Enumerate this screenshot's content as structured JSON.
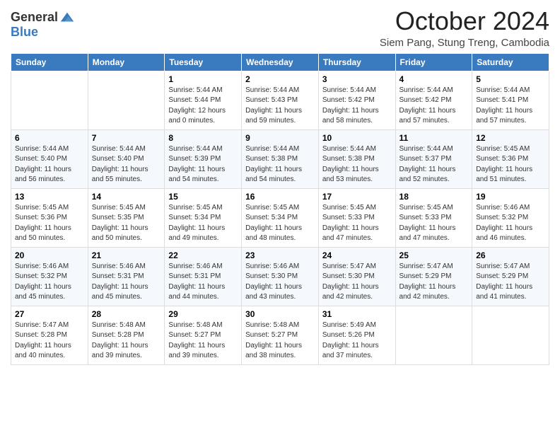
{
  "header": {
    "logo_general": "General",
    "logo_blue": "Blue",
    "title": "October 2024",
    "subtitle": "Siem Pang, Stung Treng, Cambodia"
  },
  "columns": [
    "Sunday",
    "Monday",
    "Tuesday",
    "Wednesday",
    "Thursday",
    "Friday",
    "Saturday"
  ],
  "weeks": [
    [
      {
        "day": null,
        "sunrise": null,
        "sunset": null,
        "daylight": null
      },
      {
        "day": null,
        "sunrise": null,
        "sunset": null,
        "daylight": null
      },
      {
        "day": "1",
        "sunrise": "Sunrise: 5:44 AM",
        "sunset": "Sunset: 5:44 PM",
        "daylight": "Daylight: 12 hours and 0 minutes."
      },
      {
        "day": "2",
        "sunrise": "Sunrise: 5:44 AM",
        "sunset": "Sunset: 5:43 PM",
        "daylight": "Daylight: 11 hours and 59 minutes."
      },
      {
        "day": "3",
        "sunrise": "Sunrise: 5:44 AM",
        "sunset": "Sunset: 5:42 PM",
        "daylight": "Daylight: 11 hours and 58 minutes."
      },
      {
        "day": "4",
        "sunrise": "Sunrise: 5:44 AM",
        "sunset": "Sunset: 5:42 PM",
        "daylight": "Daylight: 11 hours and 57 minutes."
      },
      {
        "day": "5",
        "sunrise": "Sunrise: 5:44 AM",
        "sunset": "Sunset: 5:41 PM",
        "daylight": "Daylight: 11 hours and 57 minutes."
      }
    ],
    [
      {
        "day": "6",
        "sunrise": "Sunrise: 5:44 AM",
        "sunset": "Sunset: 5:40 PM",
        "daylight": "Daylight: 11 hours and 56 minutes."
      },
      {
        "day": "7",
        "sunrise": "Sunrise: 5:44 AM",
        "sunset": "Sunset: 5:40 PM",
        "daylight": "Daylight: 11 hours and 55 minutes."
      },
      {
        "day": "8",
        "sunrise": "Sunrise: 5:44 AM",
        "sunset": "Sunset: 5:39 PM",
        "daylight": "Daylight: 11 hours and 54 minutes."
      },
      {
        "day": "9",
        "sunrise": "Sunrise: 5:44 AM",
        "sunset": "Sunset: 5:38 PM",
        "daylight": "Daylight: 11 hours and 54 minutes."
      },
      {
        "day": "10",
        "sunrise": "Sunrise: 5:44 AM",
        "sunset": "Sunset: 5:38 PM",
        "daylight": "Daylight: 11 hours and 53 minutes."
      },
      {
        "day": "11",
        "sunrise": "Sunrise: 5:44 AM",
        "sunset": "Sunset: 5:37 PM",
        "daylight": "Daylight: 11 hours and 52 minutes."
      },
      {
        "day": "12",
        "sunrise": "Sunrise: 5:45 AM",
        "sunset": "Sunset: 5:36 PM",
        "daylight": "Daylight: 11 hours and 51 minutes."
      }
    ],
    [
      {
        "day": "13",
        "sunrise": "Sunrise: 5:45 AM",
        "sunset": "Sunset: 5:36 PM",
        "daylight": "Daylight: 11 hours and 50 minutes."
      },
      {
        "day": "14",
        "sunrise": "Sunrise: 5:45 AM",
        "sunset": "Sunset: 5:35 PM",
        "daylight": "Daylight: 11 hours and 50 minutes."
      },
      {
        "day": "15",
        "sunrise": "Sunrise: 5:45 AM",
        "sunset": "Sunset: 5:34 PM",
        "daylight": "Daylight: 11 hours and 49 minutes."
      },
      {
        "day": "16",
        "sunrise": "Sunrise: 5:45 AM",
        "sunset": "Sunset: 5:34 PM",
        "daylight": "Daylight: 11 hours and 48 minutes."
      },
      {
        "day": "17",
        "sunrise": "Sunrise: 5:45 AM",
        "sunset": "Sunset: 5:33 PM",
        "daylight": "Daylight: 11 hours and 47 minutes."
      },
      {
        "day": "18",
        "sunrise": "Sunrise: 5:45 AM",
        "sunset": "Sunset: 5:33 PM",
        "daylight": "Daylight: 11 hours and 47 minutes."
      },
      {
        "day": "19",
        "sunrise": "Sunrise: 5:46 AM",
        "sunset": "Sunset: 5:32 PM",
        "daylight": "Daylight: 11 hours and 46 minutes."
      }
    ],
    [
      {
        "day": "20",
        "sunrise": "Sunrise: 5:46 AM",
        "sunset": "Sunset: 5:32 PM",
        "daylight": "Daylight: 11 hours and 45 minutes."
      },
      {
        "day": "21",
        "sunrise": "Sunrise: 5:46 AM",
        "sunset": "Sunset: 5:31 PM",
        "daylight": "Daylight: 11 hours and 45 minutes."
      },
      {
        "day": "22",
        "sunrise": "Sunrise: 5:46 AM",
        "sunset": "Sunset: 5:31 PM",
        "daylight": "Daylight: 11 hours and 44 minutes."
      },
      {
        "day": "23",
        "sunrise": "Sunrise: 5:46 AM",
        "sunset": "Sunset: 5:30 PM",
        "daylight": "Daylight: 11 hours and 43 minutes."
      },
      {
        "day": "24",
        "sunrise": "Sunrise: 5:47 AM",
        "sunset": "Sunset: 5:30 PM",
        "daylight": "Daylight: 11 hours and 42 minutes."
      },
      {
        "day": "25",
        "sunrise": "Sunrise: 5:47 AM",
        "sunset": "Sunset: 5:29 PM",
        "daylight": "Daylight: 11 hours and 42 minutes."
      },
      {
        "day": "26",
        "sunrise": "Sunrise: 5:47 AM",
        "sunset": "Sunset: 5:29 PM",
        "daylight": "Daylight: 11 hours and 41 minutes."
      }
    ],
    [
      {
        "day": "27",
        "sunrise": "Sunrise: 5:47 AM",
        "sunset": "Sunset: 5:28 PM",
        "daylight": "Daylight: 11 hours and 40 minutes."
      },
      {
        "day": "28",
        "sunrise": "Sunrise: 5:48 AM",
        "sunset": "Sunset: 5:28 PM",
        "daylight": "Daylight: 11 hours and 39 minutes."
      },
      {
        "day": "29",
        "sunrise": "Sunrise: 5:48 AM",
        "sunset": "Sunset: 5:27 PM",
        "daylight": "Daylight: 11 hours and 39 minutes."
      },
      {
        "day": "30",
        "sunrise": "Sunrise: 5:48 AM",
        "sunset": "Sunset: 5:27 PM",
        "daylight": "Daylight: 11 hours and 38 minutes."
      },
      {
        "day": "31",
        "sunrise": "Sunrise: 5:49 AM",
        "sunset": "Sunset: 5:26 PM",
        "daylight": "Daylight: 11 hours and 37 minutes."
      },
      {
        "day": null,
        "sunrise": null,
        "sunset": null,
        "daylight": null
      },
      {
        "day": null,
        "sunrise": null,
        "sunset": null,
        "daylight": null
      }
    ]
  ]
}
